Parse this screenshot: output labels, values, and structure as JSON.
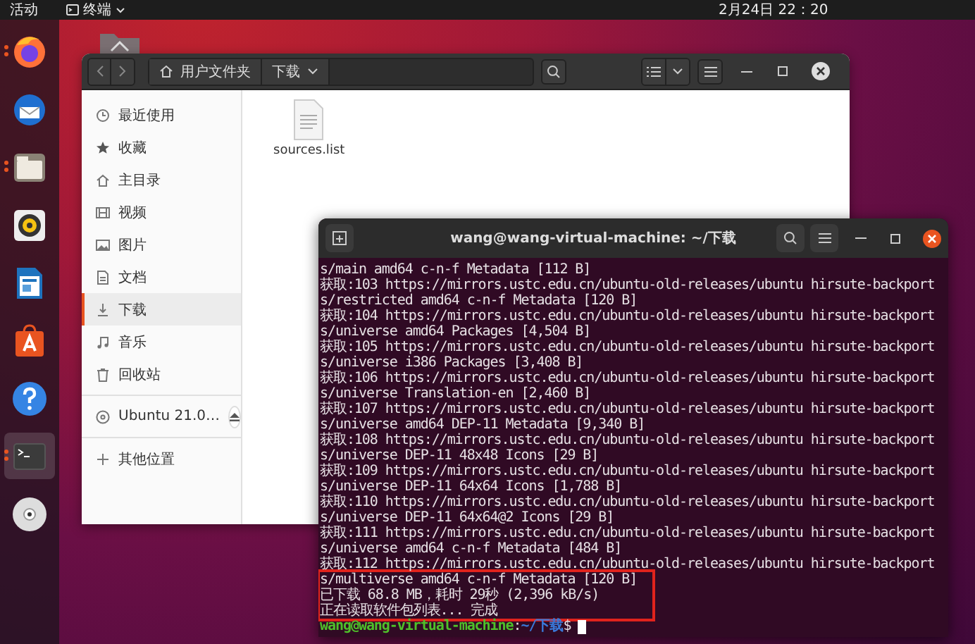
{
  "top_bar": {
    "activities": "活动",
    "app_menu": "终端",
    "clock": "2月24日  22：20"
  },
  "dock": {
    "items": [
      {
        "kind": "browser",
        "running": true,
        "selected": false
      },
      {
        "kind": "mail",
        "running": false,
        "selected": false
      },
      {
        "kind": "folder",
        "running": true,
        "selected": false
      },
      {
        "kind": "speaker",
        "running": false,
        "selected": false
      },
      {
        "kind": "document",
        "running": false,
        "selected": false
      },
      {
        "kind": "store",
        "running": false,
        "selected": false
      },
      {
        "kind": "help",
        "running": false,
        "selected": false
      },
      {
        "kind": "terminal",
        "running": true,
        "selected": true
      },
      {
        "kind": "disc",
        "running": false,
        "selected": false
      }
    ]
  },
  "file_manager": {
    "path": [
      {
        "label": "用户文件夹",
        "kind": "home"
      },
      {
        "label": "下载",
        "kind": "current"
      }
    ],
    "sidebar": {
      "items": [
        {
          "label": "最近使用",
          "kind": "recent",
          "selected": false
        },
        {
          "label": "收藏",
          "kind": "starred",
          "selected": false
        },
        {
          "label": "主目录",
          "kind": "home",
          "selected": false
        },
        {
          "label": "视频",
          "kind": "videos",
          "selected": false
        },
        {
          "label": "图片",
          "kind": "pictures",
          "selected": false
        },
        {
          "label": "文档",
          "kind": "documents",
          "selected": false
        },
        {
          "label": "下载",
          "kind": "downloads",
          "selected": true
        },
        {
          "label": "音乐",
          "kind": "music",
          "selected": false
        },
        {
          "label": "回收站",
          "kind": "trash",
          "selected": false
        }
      ],
      "device": "Ubuntu 21.0…",
      "other": "其他位置"
    },
    "files": [
      {
        "name": "sources.list"
      }
    ]
  },
  "terminal": {
    "title": "wang@wang-virtual-machine: ~/下载",
    "lines": [
      {
        "text": "s/main amd64 c-n-f Metadata [112 B]",
        "highlighted": false
      },
      {
        "text": "获取:103 https://mirrors.ustc.edu.cn/ubuntu-old-releases/ubuntu hirsute-backport",
        "highlighted": false
      },
      {
        "text": "s/restricted amd64 c-n-f Metadata [120 B]",
        "highlighted": false
      },
      {
        "text": "获取:104 https://mirrors.ustc.edu.cn/ubuntu-old-releases/ubuntu hirsute-backport",
        "highlighted": false
      },
      {
        "text": "s/universe amd64 Packages [4,504 B]",
        "highlighted": false
      },
      {
        "text": "获取:105 https://mirrors.ustc.edu.cn/ubuntu-old-releases/ubuntu hirsute-backport",
        "highlighted": false
      },
      {
        "text": "s/universe i386 Packages [3,408 B]",
        "highlighted": false
      },
      {
        "text": "获取:106 https://mirrors.ustc.edu.cn/ubuntu-old-releases/ubuntu hirsute-backport",
        "highlighted": false
      },
      {
        "text": "s/universe Translation-en [2,460 B]",
        "highlighted": false
      },
      {
        "text": "获取:107 https://mirrors.ustc.edu.cn/ubuntu-old-releases/ubuntu hirsute-backport",
        "highlighted": false
      },
      {
        "text": "s/universe amd64 DEP-11 Metadata [9,340 B]",
        "highlighted": false
      },
      {
        "text": "获取:108 https://mirrors.ustc.edu.cn/ubuntu-old-releases/ubuntu hirsute-backport",
        "highlighted": false
      },
      {
        "text": "s/universe DEP-11 48x48 Icons [29 B]",
        "highlighted": false
      },
      {
        "text": "获取:109 https://mirrors.ustc.edu.cn/ubuntu-old-releases/ubuntu hirsute-backport",
        "highlighted": false
      },
      {
        "text": "s/universe DEP-11 64x64 Icons [1,788 B]",
        "highlighted": false
      },
      {
        "text": "获取:110 https://mirrors.ustc.edu.cn/ubuntu-old-releases/ubuntu hirsute-backport",
        "highlighted": false
      },
      {
        "text": "s/universe DEP-11 64x64@2 Icons [29 B]",
        "highlighted": false
      },
      {
        "text": "获取:111 https://mirrors.ustc.edu.cn/ubuntu-old-releases/ubuntu hirsute-backport",
        "highlighted": false
      },
      {
        "text": "s/universe amd64 c-n-f Metadata [484 B]",
        "highlighted": false
      },
      {
        "text": "获取:112 https://mirrors.ustc.edu.cn/ubuntu-old-releases/ubuntu hirsute-backport",
        "highlighted": false
      },
      {
        "text": "s/multiverse amd64 c-n-f Metadata [120 B]",
        "highlighted": true
      },
      {
        "text": "已下载 68.8 MB，耗时 29秒 (2,396 kB/s)",
        "highlighted": true
      },
      {
        "text": "正在读取软件包列表... 完成",
        "highlighted": true
      }
    ],
    "prompt": {
      "user_host": "wang@wang-virtual-machine",
      "separator": ":",
      "path": "~/下载",
      "symbol": "$"
    }
  }
}
